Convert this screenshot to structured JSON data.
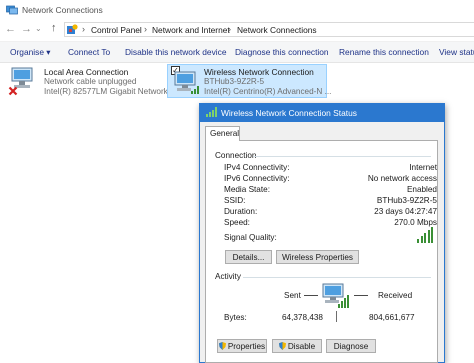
{
  "window": {
    "title": "Network Connections"
  },
  "address": {
    "crumbs": [
      "Control Panel",
      "Network and Internet",
      "Network Connections"
    ]
  },
  "toolbar": {
    "organise": "Organise ▾",
    "connect": "Connect To",
    "disable": "Disable this network device",
    "diagnose": "Diagnose this connection",
    "rename": "Rename this connection",
    "view": "View status"
  },
  "connections": [
    {
      "name": "Local Area Connection",
      "status": "Network cable unplugged",
      "adapter": "Intel(R) 82577LM Gigabit Network..."
    },
    {
      "name": "Wireless Network Connection",
      "status": "BTHub3-9Z2R-5",
      "adapter": "Intel(R) Centrino(R) Advanced-N ..."
    }
  ],
  "dialog": {
    "title": "Wireless Network Connection Status",
    "tab": "General",
    "connection_group": "Connection",
    "rows": [
      {
        "label": "IPv4 Connectivity:",
        "value": "Internet"
      },
      {
        "label": "IPv6 Connectivity:",
        "value": "No network access"
      },
      {
        "label": "Media State:",
        "value": "Enabled"
      },
      {
        "label": "SSID:",
        "value": "BTHub3-9Z2R-5"
      },
      {
        "label": "Duration:",
        "value": "23 days 04:27:47"
      },
      {
        "label": "Speed:",
        "value": "270.0 Mbps"
      }
    ],
    "signal_label": "Signal Quality:",
    "signal_bars": 5,
    "details_button": "Details...",
    "wireless_props_button": "Wireless Properties",
    "activity_group": "Activity",
    "sent_label": "Sent",
    "received_label": "Received",
    "bytes_label": "Bytes:",
    "bytes_sent": "64,378,438",
    "bytes_received": "804,661,677",
    "properties_button": "Properties",
    "disable_button": "Disable",
    "diagnose_button": "Diagnose"
  },
  "colors": {
    "accent": "#2b78cf",
    "selection": "#cce8ff",
    "link": "#1e3287",
    "signal": "#3a8f35"
  }
}
